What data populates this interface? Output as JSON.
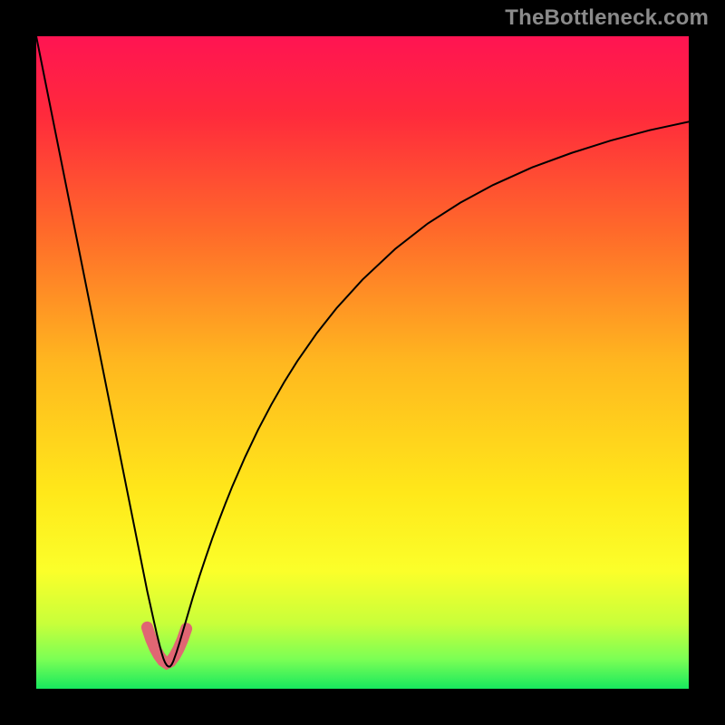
{
  "watermark": "TheBottleneck.com",
  "chart_data": {
    "type": "line",
    "title": "",
    "xlabel": "",
    "ylabel": "",
    "xlim": [
      0,
      100
    ],
    "ylim": [
      0,
      100
    ],
    "grid": false,
    "gradient_stops": [
      {
        "offset": 0.0,
        "color": "#ff1452"
      },
      {
        "offset": 0.12,
        "color": "#ff2a3c"
      },
      {
        "offset": 0.3,
        "color": "#ff6a2a"
      },
      {
        "offset": 0.5,
        "color": "#ffb71f"
      },
      {
        "offset": 0.7,
        "color": "#ffe81a"
      },
      {
        "offset": 0.82,
        "color": "#fbff2a"
      },
      {
        "offset": 0.9,
        "color": "#c8ff3a"
      },
      {
        "offset": 0.955,
        "color": "#7bff55"
      },
      {
        "offset": 1.0,
        "color": "#17e85e"
      }
    ],
    "series": [
      {
        "name": "bottleneck-curve",
        "x": [
          0.0,
          1.0,
          2.0,
          3.0,
          4.0,
          5.0,
          6.0,
          7.0,
          8.0,
          9.0,
          10.0,
          11.0,
          12.0,
          13.0,
          14.0,
          15.0,
          16.0,
          17.0,
          18.0,
          18.5,
          19.0,
          19.25,
          19.5,
          19.75,
          20.0,
          20.25,
          20.5,
          20.75,
          21.0,
          21.5,
          22.0,
          23.0,
          24.0,
          25.0,
          26.0,
          27.0,
          28.0,
          29.0,
          30.0,
          32.0,
          34.0,
          36.0,
          38.0,
          40.0,
          43.0,
          46.0,
          50.0,
          55.0,
          60.0,
          65.0,
          70.0,
          76.0,
          82.0,
          88.0,
          94.0,
          100.0
        ],
        "y": [
          100.0,
          95.0,
          90.0,
          85.0,
          80.0,
          75.0,
          70.0,
          65.0,
          60.0,
          55.0,
          50.0,
          45.0,
          40.0,
          35.0,
          30.0,
          25.0,
          20.0,
          15.0,
          10.5,
          8.3,
          6.3,
          5.4,
          4.6,
          4.0,
          3.6,
          3.4,
          3.4,
          3.7,
          4.2,
          5.6,
          7.2,
          10.6,
          14.0,
          17.2,
          20.2,
          23.1,
          25.8,
          28.4,
          30.9,
          35.5,
          39.7,
          43.5,
          47.0,
          50.2,
          54.5,
          58.3,
          62.7,
          67.4,
          71.3,
          74.5,
          77.2,
          79.9,
          82.1,
          84.0,
          85.6,
          86.9
        ],
        "stroke": "#000000",
        "stroke_width": 2
      },
      {
        "name": "minimum-marker",
        "x": [
          17.0,
          17.6,
          18.2,
          18.8,
          19.4,
          20.0,
          20.6,
          21.2,
          21.8,
          22.4,
          23.0
        ],
        "y": [
          9.4,
          7.6,
          6.2,
          5.1,
          4.3,
          3.9,
          4.2,
          5.0,
          6.1,
          7.5,
          9.2
        ],
        "stroke": "#e06673",
        "stroke_width": 13
      }
    ]
  }
}
